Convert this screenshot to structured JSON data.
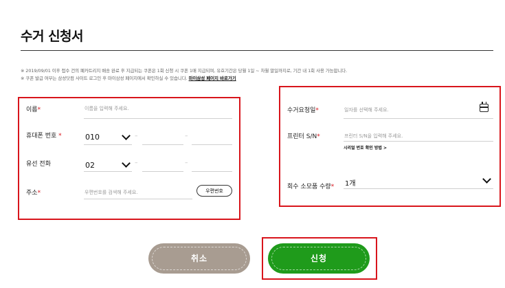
{
  "page": {
    "title": "수거 신청서"
  },
  "notices": {
    "line1": "※ 2019/09/01 이후 접수 건의 폐카트리지 배송 완료 후 지급되는 쿠폰은 1회 신청 시 쿠폰 1매 지급되며, 유효기간은 당월 1일 ~ 차월 말일까지로, 기간 내 1회 사용 가능합니다.",
    "line2_text": "※ 쿠폰 발급 여부는 삼성닷컴 사이트 로그인 후 마이삼성 페이지에서 확인하실 수 있습니다.",
    "line2_link": "마이삼성 페이지 바로가기"
  },
  "form_left": {
    "name": {
      "label": "이름",
      "required": "*",
      "placeholder": "이름을 입력해 주세요."
    },
    "mobile": {
      "label": "휴대폰 번호 ",
      "required": "*",
      "prefix": "010",
      "dash": "–"
    },
    "landline": {
      "label": "유선 전화",
      "prefix": "02",
      "dash": "–"
    },
    "address": {
      "label": "주소",
      "required": "*",
      "placeholder": "우편번호를 검색해 주세요.",
      "zip_button": "우편번호"
    }
  },
  "form_right": {
    "pickup_date": {
      "label": "수거요청일",
      "required": "*",
      "placeholder": "일자를 선택해 주세요.",
      "icon": "calendar-icon"
    },
    "printer_sn": {
      "label": "프린터 S/N",
      "required": "*",
      "placeholder": "프린터 S/N을 입력해 주세요.",
      "help_link": "시리얼 번호 확인 방법 >"
    },
    "quantity": {
      "label": "회수 소모품 수량",
      "required": "*",
      "value": "1개",
      "icon": "chevron-down-icon"
    }
  },
  "buttons": {
    "cancel": "취소",
    "submit": "신청"
  },
  "colors": {
    "highlight_red": "#d8141b",
    "cancel_bg": "#a89c91",
    "submit_bg": "#1f9b1b"
  }
}
